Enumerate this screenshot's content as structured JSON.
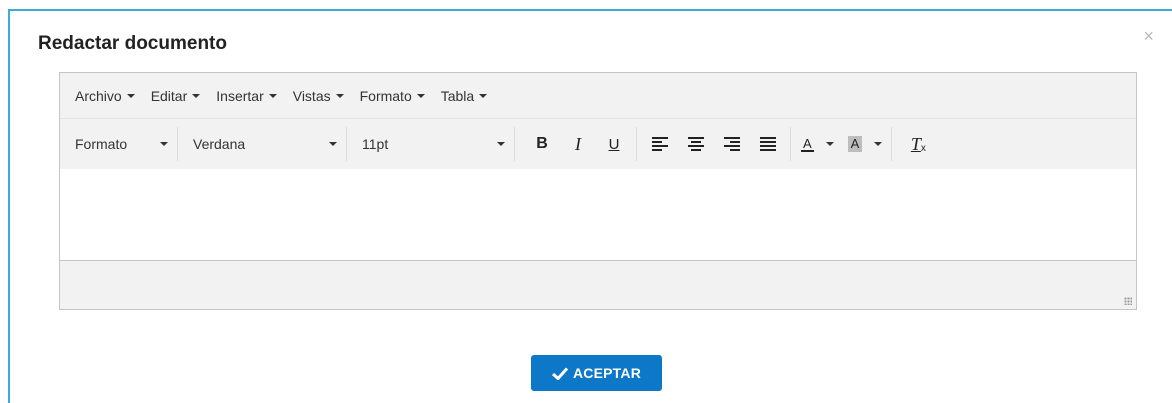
{
  "dialog": {
    "title": "Redactar documento",
    "close_symbol": "×"
  },
  "menubar": {
    "items": [
      {
        "label": "Archivo"
      },
      {
        "label": "Editar"
      },
      {
        "label": "Insertar"
      },
      {
        "label": "Vistas"
      },
      {
        "label": "Formato"
      },
      {
        "label": "Tabla"
      }
    ]
  },
  "toolbar": {
    "format_label": "Formato",
    "font_family": "Verdana",
    "font_size": "11pt",
    "bold_label": "B",
    "italic_label": "I",
    "underline_label": "U",
    "text_color_label": "A",
    "bg_color_label": "A",
    "clear_format_label": "T"
  },
  "footer": {
    "accept_label": "ACEPTAR"
  },
  "colors": {
    "accent": "#0d78c8",
    "border": "#3fa9d8",
    "toolbar_bg": "#f2f2f2"
  }
}
